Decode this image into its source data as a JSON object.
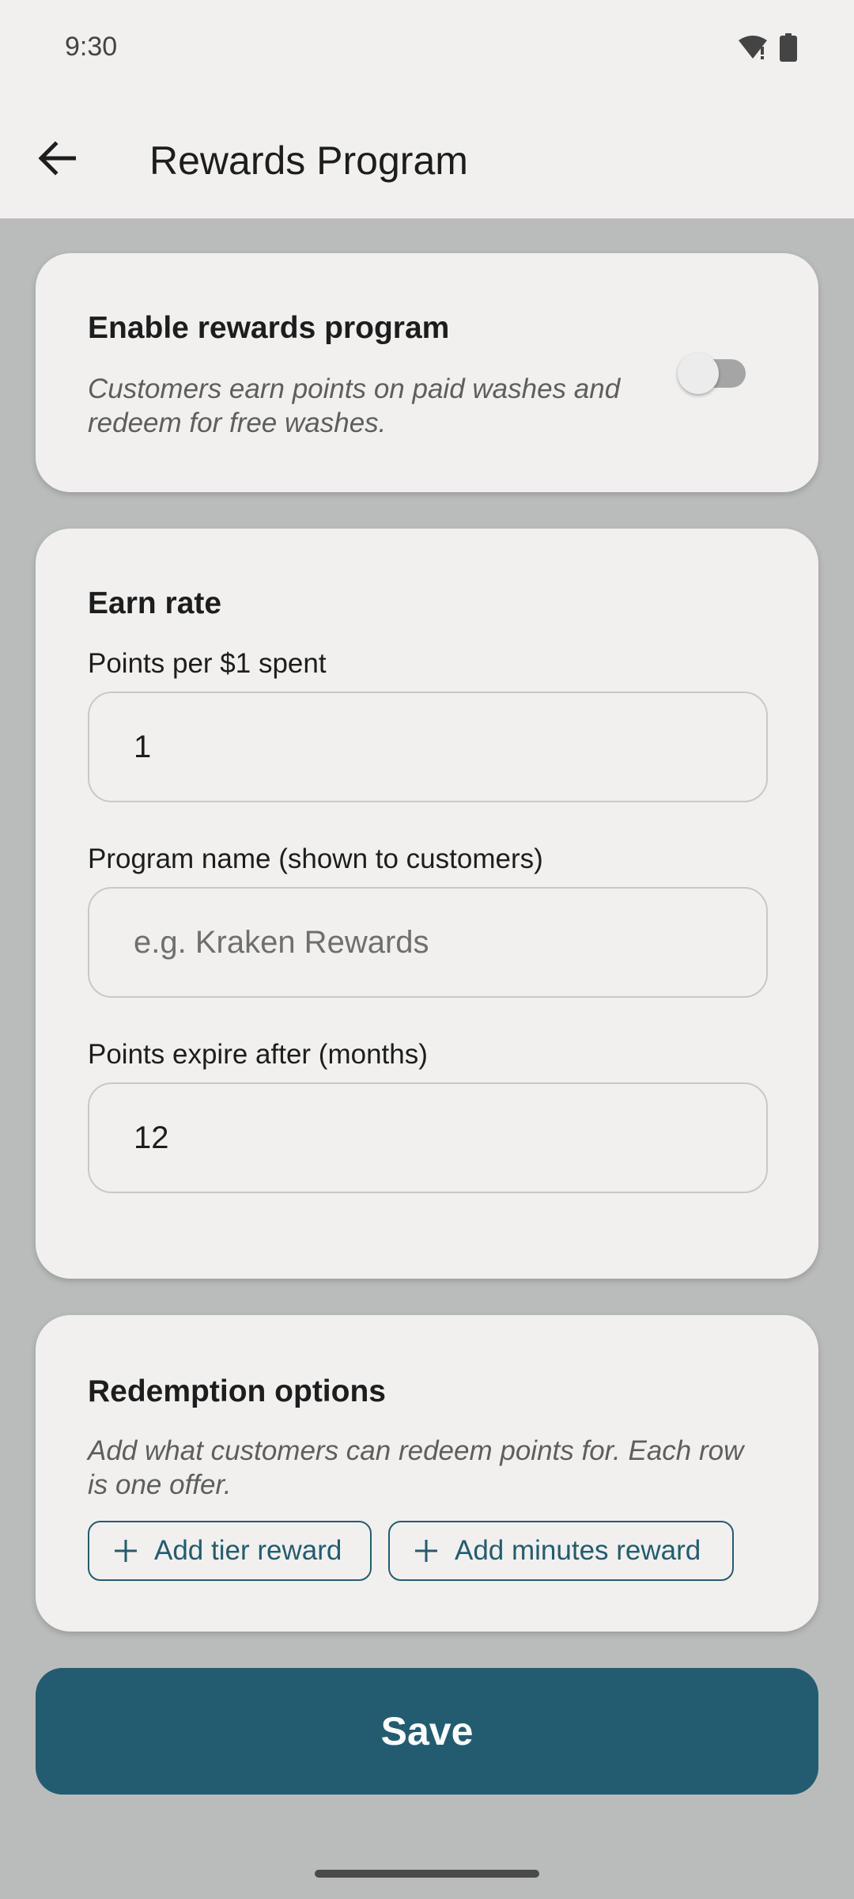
{
  "status_bar": {
    "time": "9:30",
    "icons": [
      "wifi-alert-icon",
      "battery-icon"
    ]
  },
  "app_bar": {
    "back_icon": "arrow-back-icon",
    "title": "Rewards Program"
  },
  "enable_card": {
    "title": "Enable rewards program",
    "description_line1": "Customers earn points on paid washes and",
    "description_line2": "redeem for free washes.",
    "toggle_on": false
  },
  "earn_card": {
    "title": "Earn rate",
    "points_label": "Points per $1 spent",
    "points_value": "1",
    "name_label": "Program name (shown to customers)",
    "name_value": "",
    "name_placeholder": "e.g. Kraken Rewards",
    "expire_label": "Points expire after (months)",
    "expire_value": "12"
  },
  "redemption_card": {
    "title": "Redemption options",
    "description_line1": "Add what customers can redeem points for. Each row",
    "description_line2": "is one offer.",
    "add_tier_label": "Add tier reward",
    "add_minutes_label": "Add minutes reward"
  },
  "save_label": "Save",
  "colors": {
    "primary": "#235c70",
    "background": "#babcbc",
    "surface": "#f1f0ee"
  }
}
